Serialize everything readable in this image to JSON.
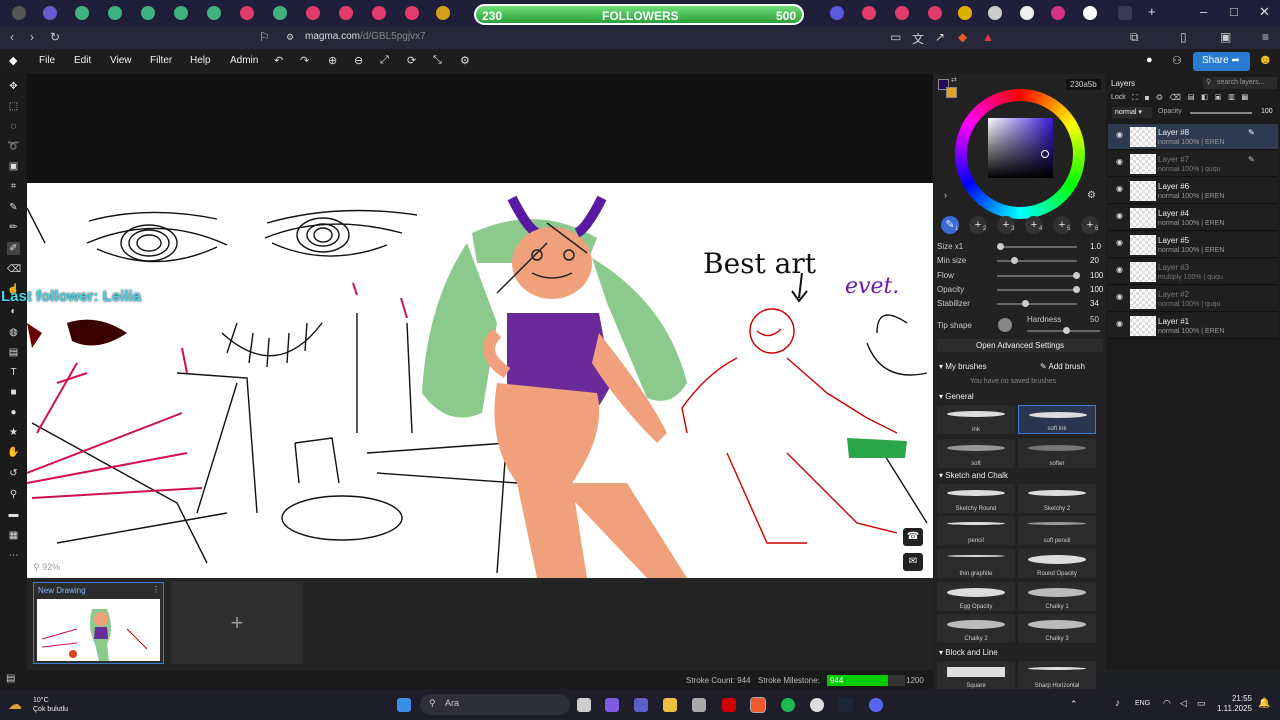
{
  "browser": {
    "url_host": "magma.com",
    "url_path": "/d/GBL5pgjvx7",
    "followers_widget": {
      "current": "230",
      "label": "FOLLOWERS",
      "goal": "500"
    }
  },
  "menu": {
    "items": [
      "File",
      "Edit",
      "View",
      "Filter",
      "Help",
      "Admin"
    ],
    "share_label": "Share"
  },
  "canvas": {
    "zoom_label": "92%",
    "overlay_text": "Last follower: Leilia",
    "drawing_text_1": "Best art",
    "drawing_text_2": "evet."
  },
  "drawings": {
    "title": "New Drawing",
    "add_label": "+"
  },
  "status": {
    "stroke_count_label": "Stroke Count: 944",
    "milestone_label": "Stroke Milestone:",
    "milestone_value": "944",
    "milestone_goal": "1200",
    "milestone_progress": 0.787
  },
  "color": {
    "hex": "230a5b",
    "primary": "#230a5b",
    "secondary": "#e0a020"
  },
  "brush_slots": [
    "1",
    "2",
    "3",
    "4",
    "5",
    "6"
  ],
  "params": [
    {
      "label": "Size x1",
      "value": "1.0"
    },
    {
      "label": "Min size",
      "value": "20"
    },
    {
      "label": "Flow",
      "value": "100"
    },
    {
      "label": "Opacity",
      "value": "100"
    },
    {
      "label": "Stabilizer",
      "value": "34"
    }
  ],
  "tip": {
    "label": "Tip shape",
    "hardness_label": "Hardness",
    "hardness_value": "50"
  },
  "advanced_label": "Open Advanced Settings",
  "brushes": {
    "my_title": "My brushes",
    "add_label": "Add brush",
    "empty_text": "You have no saved brushes",
    "sections": [
      {
        "title": "General",
        "items": [
          "ink",
          "soft ink",
          "soft",
          "softer"
        ]
      },
      {
        "title": "Sketch and Chalk",
        "items": [
          "Sketchy Round",
          "Sketchy 2",
          "pencil",
          "soft pencil",
          "thin graphite",
          "Round Opacity",
          "Egg Opacity",
          "Chalky 1",
          "Chalky 2",
          "Chalky 3"
        ]
      },
      {
        "title": "Block and Line",
        "items": [
          "Square",
          "Sharp Horizontal"
        ]
      }
    ]
  },
  "layers": {
    "title": "Layers",
    "search_placeholder": "search layers...",
    "lock_label": "Lock",
    "opacity_label": "Opacity",
    "blend": "normal",
    "opacity_value": "100",
    "items": [
      {
        "name": "Layer #8",
        "meta": "normal 100% | EREN"
      },
      {
        "name": "Layer #7",
        "meta": "normal 100% | ququ"
      },
      {
        "name": "Layer #6",
        "meta": "normal 100% | EREN"
      },
      {
        "name": "Layer #4",
        "meta": "normal 100% | EREN"
      },
      {
        "name": "Layer #5",
        "meta": "normal 100% | EREN"
      },
      {
        "name": "Layer #3",
        "meta": "multiply 100% | ququ"
      },
      {
        "name": "Layer #2",
        "meta": "normal 100% | ququ"
      },
      {
        "name": "Layer #1",
        "meta": "normal 100% | EREN"
      }
    ]
  },
  "taskbar": {
    "weather_temp": "10°C",
    "weather_desc": "Çok bulutlu",
    "search_label": "Ara",
    "lang": "ENG",
    "time": "21:55",
    "date": "1.11.2025"
  }
}
